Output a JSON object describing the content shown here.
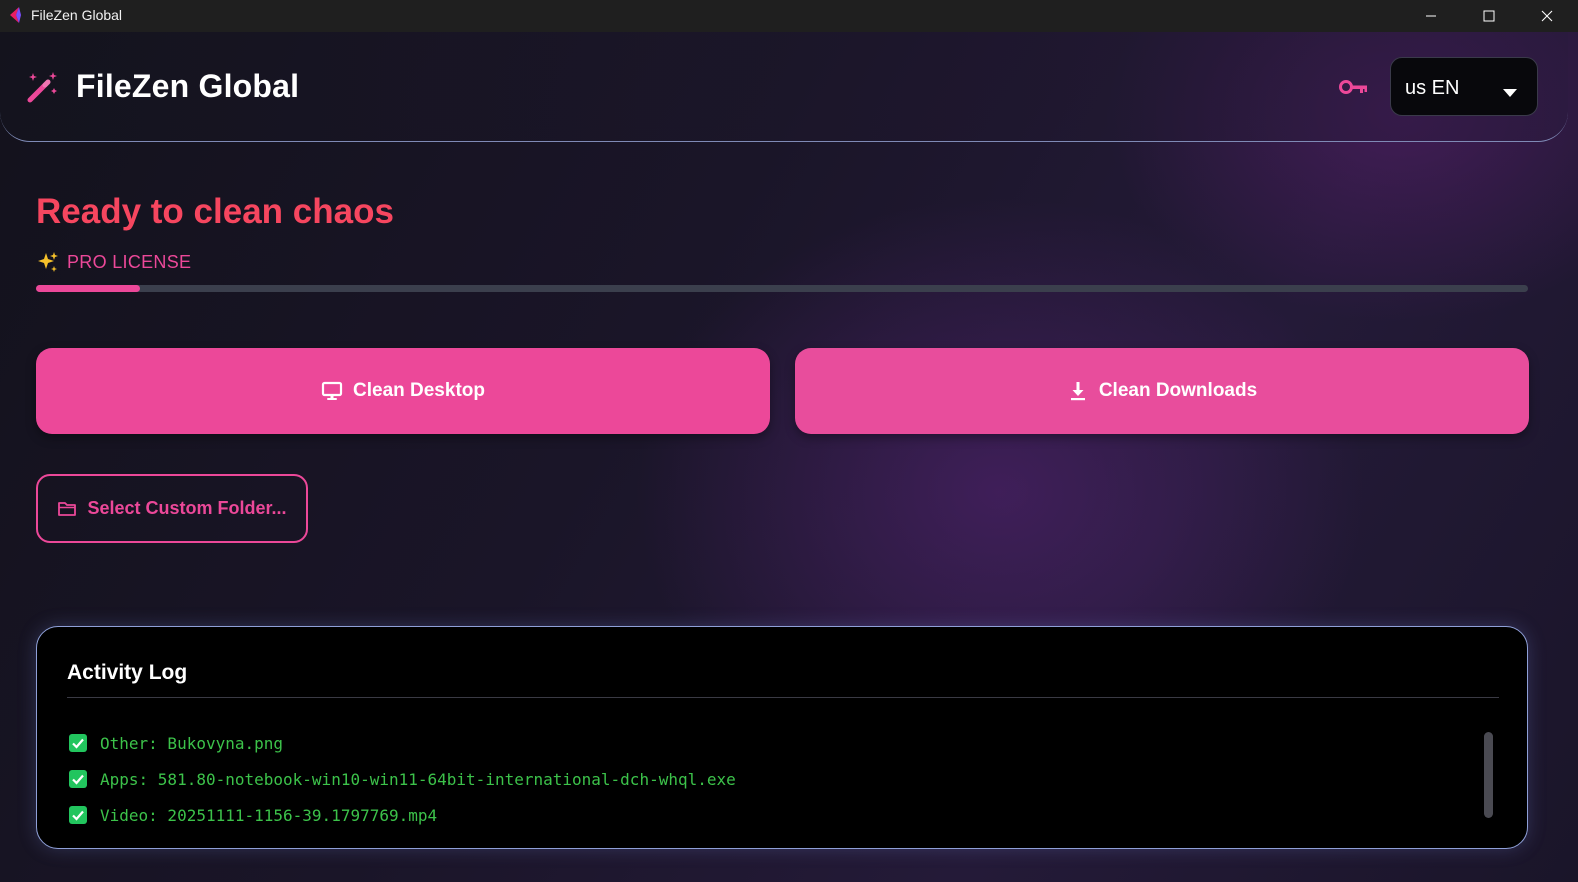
{
  "window": {
    "title": "FileZen Global"
  },
  "header": {
    "brand": "FileZen Global",
    "language_label": "us EN"
  },
  "status": {
    "title": "Ready to clean chaos",
    "license_label": "PRO LICENSE",
    "progress": 0.07
  },
  "actions": {
    "clean_desktop_label": "Clean Desktop",
    "clean_downloads_label": "Clean Downloads",
    "custom_folder_label": "Select Custom Folder..."
  },
  "log": {
    "title": "Activity Log",
    "items": [
      "Other: Bukovyna.png",
      "Apps: 581.80-notebook-win10-win11-64bit-international-dch-whql.exe",
      "Video: 20251111-1156-39.1797769.mp4"
    ]
  },
  "colors": {
    "accent": "#ec4899",
    "status_title": "#f6465f",
    "log_text": "#3cc24a",
    "check": "#22c55e"
  },
  "icons": {
    "app": "filezen-app-icon",
    "logo": "magic-wand-icon",
    "key": "key-icon",
    "caret": "caret-down-icon",
    "sparkle": "sparkles-icon",
    "desktop": "desktop-monitor-icon",
    "downloads": "download-icon",
    "folder": "folder-icon",
    "check": "checkbox-checked-icon"
  }
}
